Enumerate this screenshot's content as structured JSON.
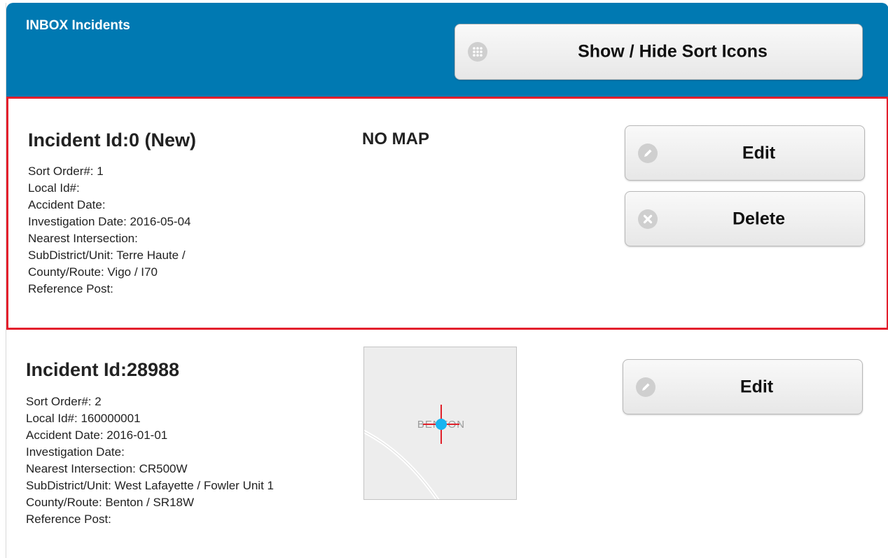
{
  "header": {
    "title": "INBOX Incidents",
    "sort_button_label": "Show / Hide Sort Icons",
    "sort_button_icon": "grid-icon",
    "background_color": "#0079b2"
  },
  "incidents": [
    {
      "title": "Incident Id:0 (New)",
      "selected": true,
      "highlight_color": "#e31e2c",
      "fields": [
        "Sort Order#: 1",
        "Local Id#:",
        "Accident Date:",
        "Investigation Date: 2016-05-04",
        "Nearest Intersection:",
        "SubDistrict/Unit: Terre Haute /",
        "County/Route: Vigo / I70",
        "Reference Post:"
      ],
      "map_text": "NO MAP",
      "edit_label": "Edit",
      "edit_icon": "pencil-icon",
      "delete_label": "Delete",
      "delete_icon": "close-circle-icon"
    },
    {
      "title": "Incident Id:28988",
      "selected": false,
      "fields": [
        "Sort Order#: 2",
        "Local Id#: 160000001",
        "Accident Date: 2016-01-01",
        "Investigation Date:",
        "Nearest Intersection: CR500W",
        "SubDistrict/Unit: West Lafayette / Fowler Unit 1",
        "County/Route: Benton / SR18W",
        "Reference Post:"
      ],
      "map_label": "BENTON",
      "edit_label": "Edit",
      "edit_icon": "pencil-icon"
    }
  ]
}
